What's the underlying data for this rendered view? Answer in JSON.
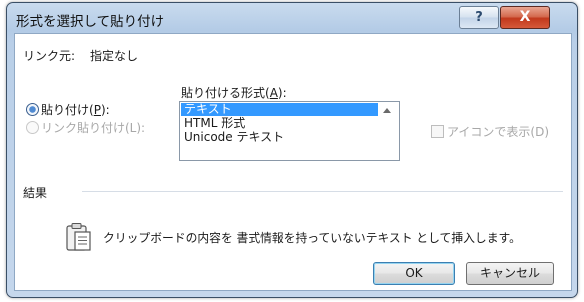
{
  "window": {
    "title": "形式を選択して貼り付け",
    "help_label": "?",
    "close_label": "X"
  },
  "source": {
    "label": "リンク元:",
    "value": "指定なし"
  },
  "format": {
    "label_prefix": "貼り付ける形式(",
    "label_key": "A",
    "label_suffix": "):",
    "items": [
      "テキスト",
      "HTML 形式",
      "Unicode テキスト"
    ]
  },
  "options": {
    "paste": {
      "prefix": "貼り付け(",
      "key": "P",
      "suffix": "):"
    },
    "paste_link": "リンク貼り付け(L):",
    "display_as_icon": "アイコンで表示(D)"
  },
  "result": {
    "heading": "結果",
    "message": "クリップボードの内容を 書式情報を持っていないテキスト として挿入します。"
  },
  "buttons": {
    "ok": "OK",
    "cancel": "キャンセル"
  },
  "colors": {
    "accent": "#3399ff",
    "close": "#c1391d"
  }
}
